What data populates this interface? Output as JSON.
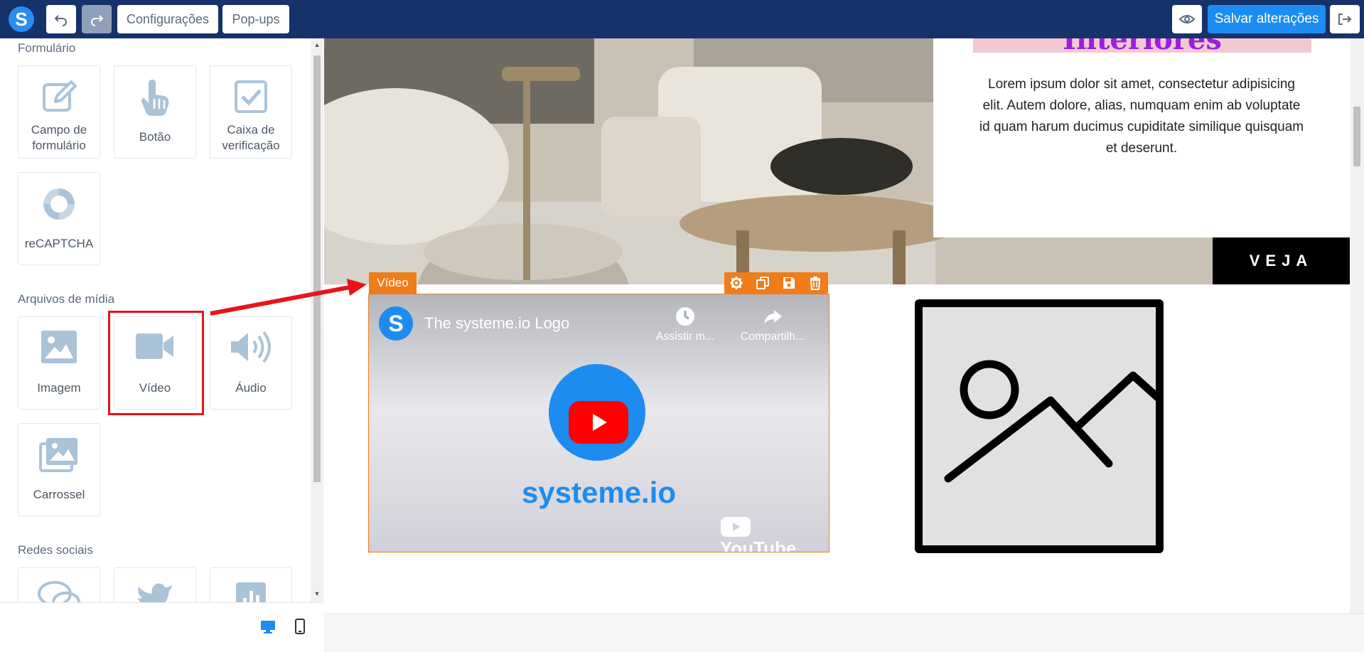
{
  "topbar": {
    "logo": "S",
    "undo_label": "↶",
    "redo_label": "↷",
    "settings_label": "Configurações",
    "popups_label": "Pop-ups",
    "save_label": "Salvar alterações",
    "icons": [
      "undo-icon",
      "redo-icon",
      "eye-icon",
      "exit-icon"
    ]
  },
  "sidebar": {
    "sections": [
      {
        "title": "Formulário",
        "items": [
          {
            "label_line1": "Campo de",
            "label_line2": "formulário",
            "icon": "pencil-icon"
          },
          {
            "label_line1": "Botão",
            "label_line2": "",
            "icon": "hand-pointer-icon"
          },
          {
            "label_line1": "Caixa de",
            "label_line2": "verificação",
            "icon": "checkbox-icon"
          },
          {
            "label_line1": "reCAPTCHA",
            "label_line2": "",
            "icon": "recaptcha-icon"
          }
        ]
      },
      {
        "title": "Arquivos de mídia",
        "items": [
          {
            "label_line1": "Imagem",
            "label_line2": "",
            "icon": "image-icon"
          },
          {
            "label_line1": "Vídeo",
            "label_line2": "",
            "icon": "video-camera-icon"
          },
          {
            "label_line1": "Áudio",
            "label_line2": "",
            "icon": "speaker-icon"
          },
          {
            "label_line1": "Carrossel",
            "label_line2": "",
            "icon": "carousel-icon"
          }
        ]
      },
      {
        "title": "Redes sociais",
        "items": [
          {
            "icon": "comments-icon"
          },
          {
            "icon": "twitter-icon"
          },
          {
            "icon": "bar-chart-icon"
          }
        ]
      }
    ],
    "devices": [
      "desktop-icon",
      "mobile-icon"
    ]
  },
  "page": {
    "heading_fragment": "Interiores",
    "lorem": "Lorem ipsum dolor sit amet, consectetur adipisicing elit. Autem dolore, alias, numquam enim ab voluptate id quam harum ducimus cupiditate similique quisquam et deserunt.",
    "cta": "VEJA",
    "video_label": "Vídeo",
    "video_tools": [
      "gear-icon",
      "copy-icon",
      "save-icon",
      "trash-icon"
    ],
    "video": {
      "channel_logo": "S",
      "title": "The systeme.io Logo",
      "watch_later": "Assistir m...",
      "share": "Compartilh...",
      "brand": "systeme.io",
      "yt_watermark": "YouTube"
    }
  },
  "colors": {
    "topbar": "#16326b",
    "primary": "#1d8cf0",
    "selection_orange": "#f07c1a",
    "highlight_red": "#e8141b",
    "icon_light_blue": "#aac3d9"
  }
}
